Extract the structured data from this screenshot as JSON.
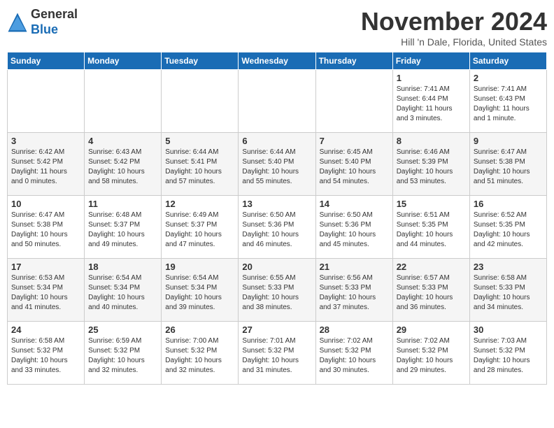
{
  "logo": {
    "general": "General",
    "blue": "Blue"
  },
  "header": {
    "month": "November 2024",
    "location": "Hill 'n Dale, Florida, United States"
  },
  "days_of_week": [
    "Sunday",
    "Monday",
    "Tuesday",
    "Wednesday",
    "Thursday",
    "Friday",
    "Saturday"
  ],
  "weeks": [
    [
      {
        "day": "",
        "info": ""
      },
      {
        "day": "",
        "info": ""
      },
      {
        "day": "",
        "info": ""
      },
      {
        "day": "",
        "info": ""
      },
      {
        "day": "",
        "info": ""
      },
      {
        "day": "1",
        "info": "Sunrise: 7:41 AM\nSunset: 6:44 PM\nDaylight: 11 hours\nand 3 minutes."
      },
      {
        "day": "2",
        "info": "Sunrise: 7:41 AM\nSunset: 6:43 PM\nDaylight: 11 hours\nand 1 minute."
      }
    ],
    [
      {
        "day": "3",
        "info": "Sunrise: 6:42 AM\nSunset: 5:42 PM\nDaylight: 11 hours\nand 0 minutes."
      },
      {
        "day": "4",
        "info": "Sunrise: 6:43 AM\nSunset: 5:42 PM\nDaylight: 10 hours\nand 58 minutes."
      },
      {
        "day": "5",
        "info": "Sunrise: 6:44 AM\nSunset: 5:41 PM\nDaylight: 10 hours\nand 57 minutes."
      },
      {
        "day": "6",
        "info": "Sunrise: 6:44 AM\nSunset: 5:40 PM\nDaylight: 10 hours\nand 55 minutes."
      },
      {
        "day": "7",
        "info": "Sunrise: 6:45 AM\nSunset: 5:40 PM\nDaylight: 10 hours\nand 54 minutes."
      },
      {
        "day": "8",
        "info": "Sunrise: 6:46 AM\nSunset: 5:39 PM\nDaylight: 10 hours\nand 53 minutes."
      },
      {
        "day": "9",
        "info": "Sunrise: 6:47 AM\nSunset: 5:38 PM\nDaylight: 10 hours\nand 51 minutes."
      }
    ],
    [
      {
        "day": "10",
        "info": "Sunrise: 6:47 AM\nSunset: 5:38 PM\nDaylight: 10 hours\nand 50 minutes."
      },
      {
        "day": "11",
        "info": "Sunrise: 6:48 AM\nSunset: 5:37 PM\nDaylight: 10 hours\nand 49 minutes."
      },
      {
        "day": "12",
        "info": "Sunrise: 6:49 AM\nSunset: 5:37 PM\nDaylight: 10 hours\nand 47 minutes."
      },
      {
        "day": "13",
        "info": "Sunrise: 6:50 AM\nSunset: 5:36 PM\nDaylight: 10 hours\nand 46 minutes."
      },
      {
        "day": "14",
        "info": "Sunrise: 6:50 AM\nSunset: 5:36 PM\nDaylight: 10 hours\nand 45 minutes."
      },
      {
        "day": "15",
        "info": "Sunrise: 6:51 AM\nSunset: 5:35 PM\nDaylight: 10 hours\nand 44 minutes."
      },
      {
        "day": "16",
        "info": "Sunrise: 6:52 AM\nSunset: 5:35 PM\nDaylight: 10 hours\nand 42 minutes."
      }
    ],
    [
      {
        "day": "17",
        "info": "Sunrise: 6:53 AM\nSunset: 5:34 PM\nDaylight: 10 hours\nand 41 minutes."
      },
      {
        "day": "18",
        "info": "Sunrise: 6:54 AM\nSunset: 5:34 PM\nDaylight: 10 hours\nand 40 minutes."
      },
      {
        "day": "19",
        "info": "Sunrise: 6:54 AM\nSunset: 5:34 PM\nDaylight: 10 hours\nand 39 minutes."
      },
      {
        "day": "20",
        "info": "Sunrise: 6:55 AM\nSunset: 5:33 PM\nDaylight: 10 hours\nand 38 minutes."
      },
      {
        "day": "21",
        "info": "Sunrise: 6:56 AM\nSunset: 5:33 PM\nDaylight: 10 hours\nand 37 minutes."
      },
      {
        "day": "22",
        "info": "Sunrise: 6:57 AM\nSunset: 5:33 PM\nDaylight: 10 hours\nand 36 minutes."
      },
      {
        "day": "23",
        "info": "Sunrise: 6:58 AM\nSunset: 5:33 PM\nDaylight: 10 hours\nand 34 minutes."
      }
    ],
    [
      {
        "day": "24",
        "info": "Sunrise: 6:58 AM\nSunset: 5:32 PM\nDaylight: 10 hours\nand 33 minutes."
      },
      {
        "day": "25",
        "info": "Sunrise: 6:59 AM\nSunset: 5:32 PM\nDaylight: 10 hours\nand 32 minutes."
      },
      {
        "day": "26",
        "info": "Sunrise: 7:00 AM\nSunset: 5:32 PM\nDaylight: 10 hours\nand 32 minutes."
      },
      {
        "day": "27",
        "info": "Sunrise: 7:01 AM\nSunset: 5:32 PM\nDaylight: 10 hours\nand 31 minutes."
      },
      {
        "day": "28",
        "info": "Sunrise: 7:02 AM\nSunset: 5:32 PM\nDaylight: 10 hours\nand 30 minutes."
      },
      {
        "day": "29",
        "info": "Sunrise: 7:02 AM\nSunset: 5:32 PM\nDaylight: 10 hours\nand 29 minutes."
      },
      {
        "day": "30",
        "info": "Sunrise: 7:03 AM\nSunset: 5:32 PM\nDaylight: 10 hours\nand 28 minutes."
      }
    ]
  ]
}
